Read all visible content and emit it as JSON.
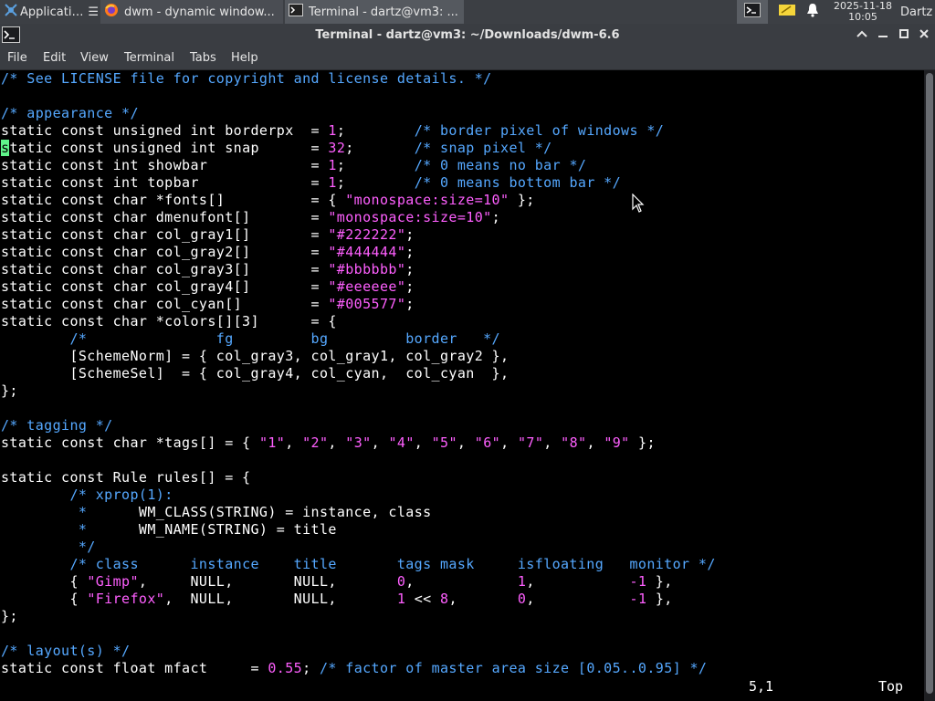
{
  "taskbar": {
    "apps_label": "Applications",
    "apps_suffix": "☰",
    "firefox_label": "dwm - dynamic window...",
    "terminal_label": "Terminal - dartz@vm3: ...",
    "clock_date": "2025-11-18",
    "clock_time": "10:05",
    "user": "Dartz"
  },
  "window": {
    "title": "Terminal - dartz@vm3: ~/Downloads/dwm-6.6"
  },
  "menu": [
    "File",
    "Edit",
    "View",
    "Terminal",
    "Tabs",
    "Help"
  ],
  "editor": {
    "lines": [
      [
        [
          "c",
          "/* See LICENSE file for copyright and license details. */"
        ]
      ],
      [],
      [
        [
          "c",
          "/* appearance */"
        ]
      ],
      [
        [
          "k",
          "static const unsigned int borderpx  = "
        ],
        [
          "n",
          "1"
        ],
        [
          "k",
          ";        "
        ],
        [
          "c",
          "/* border pixel of windows */"
        ]
      ],
      [
        [
          "cur",
          "s"
        ],
        [
          "k",
          "tatic const unsigned int snap      = "
        ],
        [
          "n",
          "32"
        ],
        [
          "k",
          ";       "
        ],
        [
          "c",
          "/* snap pixel */"
        ]
      ],
      [
        [
          "k",
          "static const int showbar            = "
        ],
        [
          "n",
          "1"
        ],
        [
          "k",
          ";        "
        ],
        [
          "c",
          "/* 0 means no bar */"
        ]
      ],
      [
        [
          "k",
          "static const int topbar             = "
        ],
        [
          "n",
          "1"
        ],
        [
          "k",
          ";        "
        ],
        [
          "c",
          "/* 0 means bottom bar */"
        ]
      ],
      [
        [
          "k",
          "static const char *fonts[]          = { "
        ],
        [
          "s",
          "\"monospace:size=10\""
        ],
        [
          "k",
          " };"
        ]
      ],
      [
        [
          "k",
          "static const char dmenufont[]       = "
        ],
        [
          "s",
          "\"monospace:size=10\""
        ],
        [
          "k",
          ";"
        ]
      ],
      [
        [
          "k",
          "static const char col_gray1[]       = "
        ],
        [
          "s",
          "\"#222222\""
        ],
        [
          "k",
          ";"
        ]
      ],
      [
        [
          "k",
          "static const char col_gray2[]       = "
        ],
        [
          "s",
          "\"#444444\""
        ],
        [
          "k",
          ";"
        ]
      ],
      [
        [
          "k",
          "static const char col_gray3[]       = "
        ],
        [
          "s",
          "\"#bbbbbb\""
        ],
        [
          "k",
          ";"
        ]
      ],
      [
        [
          "k",
          "static const char col_gray4[]       = "
        ],
        [
          "s",
          "\"#eeeeee\""
        ],
        [
          "k",
          ";"
        ]
      ],
      [
        [
          "k",
          "static const char col_cyan[]        = "
        ],
        [
          "s",
          "\"#005577\""
        ],
        [
          "k",
          ";"
        ]
      ],
      [
        [
          "k",
          "static const char *colors[][3]      = {"
        ]
      ],
      [
        [
          "k",
          "        "
        ],
        [
          "c",
          "/*               fg         bg         border   */"
        ]
      ],
      [
        [
          "k",
          "        [SchemeNorm] = { col_gray3, col_gray1, col_gray2 },"
        ]
      ],
      [
        [
          "k",
          "        [SchemeSel]  = { col_gray4, col_cyan,  col_cyan  },"
        ]
      ],
      [
        [
          "k",
          "};"
        ]
      ],
      [],
      [
        [
          "c",
          "/* tagging */"
        ]
      ],
      [
        [
          "k",
          "static const char *tags[] = { "
        ],
        [
          "s",
          "\"1\""
        ],
        [
          "k",
          ", "
        ],
        [
          "s",
          "\"2\""
        ],
        [
          "k",
          ", "
        ],
        [
          "s",
          "\"3\""
        ],
        [
          "k",
          ", "
        ],
        [
          "s",
          "\"4\""
        ],
        [
          "k",
          ", "
        ],
        [
          "s",
          "\"5\""
        ],
        [
          "k",
          ", "
        ],
        [
          "s",
          "\"6\""
        ],
        [
          "k",
          ", "
        ],
        [
          "s",
          "\"7\""
        ],
        [
          "k",
          ", "
        ],
        [
          "s",
          "\"8\""
        ],
        [
          "k",
          ", "
        ],
        [
          "s",
          "\"9\""
        ],
        [
          "k",
          " };"
        ]
      ],
      [],
      [
        [
          "k",
          "static const Rule rules[] = {"
        ]
      ],
      [
        [
          "k",
          "        "
        ],
        [
          "c",
          "/* xprop(1):"
        ]
      ],
      [
        [
          "c",
          "         *      "
        ],
        [
          "k",
          "WM_CLASS(STRING) = instance, class"
        ]
      ],
      [
        [
          "c",
          "         *      "
        ],
        [
          "k",
          "WM_NAME(STRING) = title"
        ]
      ],
      [
        [
          "c",
          "         */"
        ]
      ],
      [
        [
          "k",
          "        "
        ],
        [
          "c",
          "/* class      instance    title       tags mask     isfloating   monitor */"
        ]
      ],
      [
        [
          "k",
          "        { "
        ],
        [
          "s",
          "\"Gimp\""
        ],
        [
          "k",
          ",     NULL,       NULL,       "
        ],
        [
          "n",
          "0"
        ],
        [
          "k",
          ",            "
        ],
        [
          "n",
          "1"
        ],
        [
          "k",
          ",           "
        ],
        [
          "n",
          "-1"
        ],
        [
          "k",
          " },"
        ]
      ],
      [
        [
          "k",
          "        { "
        ],
        [
          "s",
          "\"Firefox\""
        ],
        [
          "k",
          ",  NULL,       NULL,       "
        ],
        [
          "n",
          "1"
        ],
        [
          "k",
          " << "
        ],
        [
          "n",
          "8"
        ],
        [
          "k",
          ",       "
        ],
        [
          "n",
          "0"
        ],
        [
          "k",
          ",           "
        ],
        [
          "n",
          "-1"
        ],
        [
          "k",
          " },"
        ]
      ],
      [
        [
          "k",
          "};"
        ]
      ],
      [],
      [
        [
          "c",
          "/* layout(s) */"
        ]
      ],
      [
        [
          "k",
          "static const float mfact     = "
        ],
        [
          "n",
          "0.55"
        ],
        [
          "k",
          "; "
        ],
        [
          "c",
          "/* factor of master area size [0.05..0.95] */"
        ]
      ]
    ],
    "status_position": "5,1",
    "status_scroll": "Top"
  },
  "icons": {
    "apps": "xfce-mouse-icon",
    "firefox": "firefox-icon",
    "terminal": "terminal-icon",
    "notes": "notes-icon",
    "bell": "bell-icon"
  },
  "colors": {
    "panel_bg": "#3c3f44",
    "terminal_bg": "#000000",
    "comment": "#55a8ff",
    "string_number": "#ff5fff",
    "cursor": "#5ff48a"
  }
}
